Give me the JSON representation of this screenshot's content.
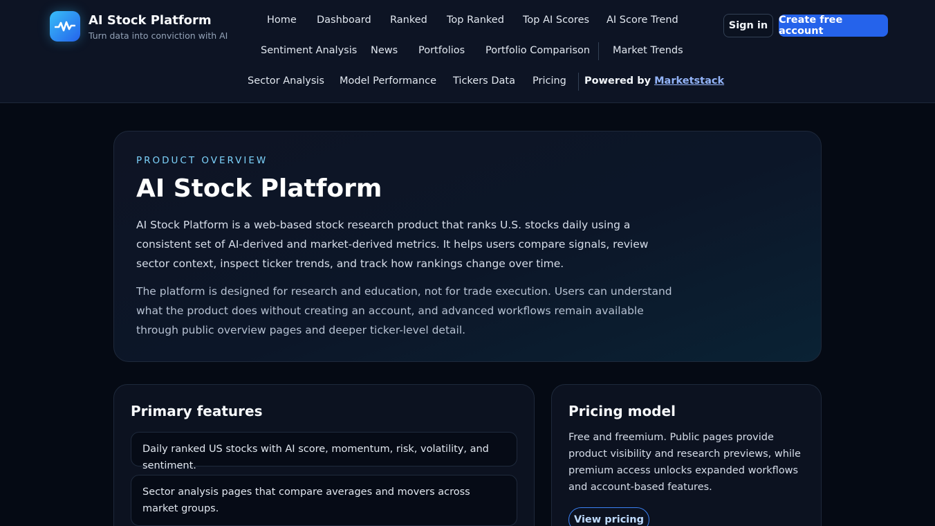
{
  "brand": {
    "title": "AI Stock Platform",
    "tagline": "Turn data into conviction with AI",
    "logo_icon": "pulse-wave-icon"
  },
  "nav": {
    "home": "Home",
    "dashboard": "Dashboard",
    "ranked": "Ranked",
    "top_ranked": "Top Ranked",
    "top_ai_scores": "Top AI Scores",
    "ai_score_trend": "AI Score Trend",
    "sentiment_analysis": "Sentiment Analysis",
    "news": "News",
    "portfolios": "Portfolios",
    "portfolio_comparison": "Portfolio Comparison",
    "market_trends": "Market Trends",
    "sector_analysis": "Sector Analysis",
    "model_performance": "Model Performance",
    "tickers_data": "Tickers Data",
    "pricing": "Pricing",
    "powered_by": "Powered by",
    "powered_by_link": "Marketstack"
  },
  "auth": {
    "sign_in": "Sign in",
    "create_account": "Create free account"
  },
  "hero": {
    "eyebrow": "PRODUCT OVERVIEW",
    "title": "AI Stock Platform",
    "paragraph_1": "AI Stock Platform is a web-based stock research product that ranks U.S. stocks daily using a consistent set of AI-derived and market-derived metrics. It helps users compare signals, review sector context, inspect ticker trends, and track how rankings change over time.",
    "paragraph_2": "The platform is designed for research and education, not for trade execution. Users can understand what the product does without creating an account, and advanced workflows remain available through public overview pages and deeper ticker-level detail."
  },
  "features": {
    "title": "Primary features",
    "items": [
      "Daily ranked US stocks with AI score, momentum, risk, volatility, and sentiment.",
      "Sector analysis pages that compare averages and movers across market groups."
    ]
  },
  "pricing": {
    "title": "Pricing model",
    "text": "Free and freemium. Public pages provide product visibility and research previews, while premium access unlocks expanded workflows and account-based features.",
    "button": "View pricing"
  },
  "colors": {
    "accent": "#2563eb",
    "eyebrow": "#7dd3fc",
    "background": "#050a14"
  }
}
